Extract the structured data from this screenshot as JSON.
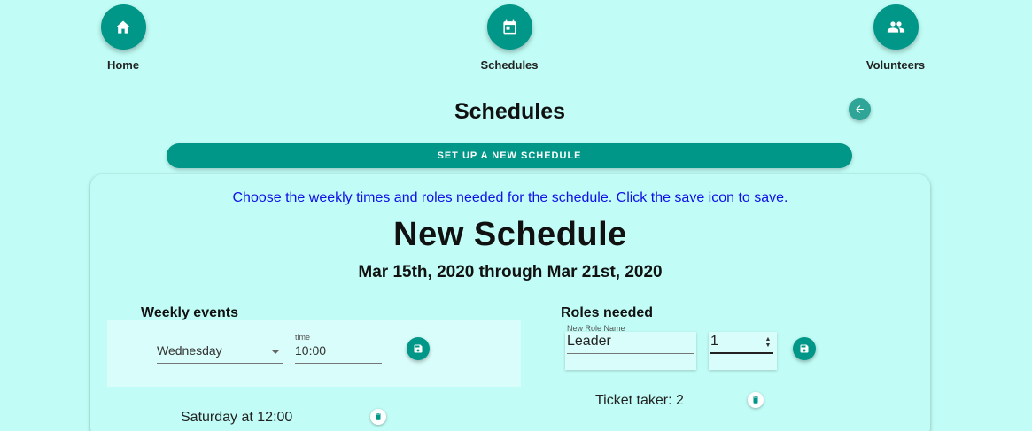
{
  "nav": {
    "home_label": "Home",
    "schedules_label": "Schedules",
    "volunteers_label": "Volunteers"
  },
  "page": {
    "title": "Schedules",
    "setup_label": "SET UP A NEW SCHEDULE"
  },
  "card": {
    "instructions": "Choose the weekly times and roles needed for the schedule. Click the save icon to save.",
    "title": "New Schedule",
    "range": "Mar 15th, 2020 through Mar 21st, 2020"
  },
  "weekly_events": {
    "heading": "Weekly events",
    "day_value": "Wednesday",
    "time_label": "time",
    "time_value": "10:00",
    "events": [
      "Saturday at 12:00"
    ]
  },
  "roles": {
    "heading": "Roles needed",
    "name_label": "New Role Name",
    "name_value": "Leader",
    "count_value": "1",
    "items": [
      "Ticket taker: 2"
    ]
  },
  "colors": {
    "background": "#c1fdf6",
    "accent": "#009688",
    "instructions_text": "#1010e8"
  }
}
